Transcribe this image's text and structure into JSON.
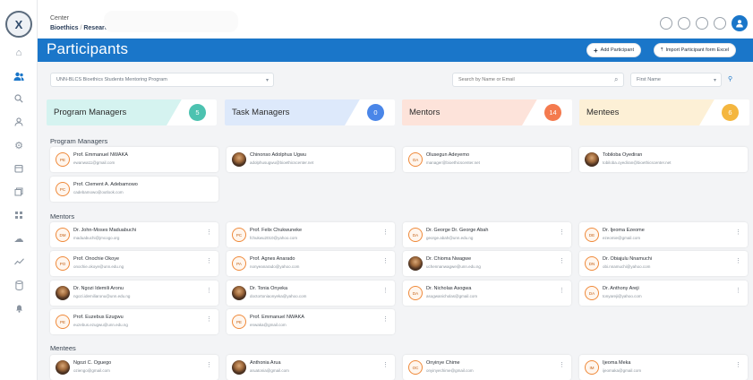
{
  "app": {
    "logo_text": "X",
    "breadcrumb_top": "Center",
    "breadcrumb_parent": "Bioethics",
    "breadcrumb_current": "Research"
  },
  "icons": {
    "sidebar": [
      "home-icon",
      "users-icon",
      "search-icon",
      "user-icon",
      "settings-icon",
      "calendar-icon",
      "gallery-icon",
      "grid-icon",
      "cloud-icon",
      "chart-icon",
      "database-icon",
      "bell-icon"
    ],
    "header": [
      "help-icon",
      "settings-icon",
      "notification-icon",
      "message-icon",
      "user-avatar-icon"
    ]
  },
  "colors": {
    "primary": "#1a76c9",
    "program_managers_bg": "#d5f3f0",
    "program_managers_count": "#4cc2b0",
    "task_managers_bg": "#dde9fb",
    "task_managers_count": "#4a86e8",
    "mentors_bg": "#fde3da",
    "mentors_count": "#f47a4e",
    "mentees_bg": "#fdf0d6",
    "mentees_count": "#f4b63f"
  },
  "header": {
    "title": "Participants",
    "add_button": "Add Participant",
    "import_button": "Import Participant form Excel"
  },
  "filters": {
    "program": "UNN-BLCS Bioethics Students Mentoring Program",
    "search_placeholder": "Search by Name or Email",
    "sort": "First Name"
  },
  "categories": [
    {
      "label": "Program Managers",
      "count": "5"
    },
    {
      "label": "Task Managers",
      "count": "0"
    },
    {
      "label": "Mentors",
      "count": "14"
    },
    {
      "label": "Mentees",
      "count": "6"
    }
  ],
  "sections": {
    "program_managers": "Program Managers",
    "mentors": "Mentors",
    "mentees": "Mentees"
  },
  "program_managers": [
    {
      "initials": "PE",
      "name": "Prof. Emmanuel NWAKA",
      "email": "ewanwa11@gmail.com"
    },
    {
      "initials": "",
      "name": "Chinonso Adolphus Ugwu",
      "email": "adolphusugwu@bioethicscenter.net"
    },
    {
      "initials": "OA",
      "name": "Olusegun Adeyemo",
      "email": "manager@bioethicscenter.net"
    },
    {
      "initials": "",
      "name": "Tobiloba Oyediran",
      "email": "tobiloba.oyediran@bioethicscenter.net"
    },
    {
      "initials": "PC",
      "name": "Prof. Clement A. Adebamowo",
      "email": "cadebamowo@outlook.com"
    }
  ],
  "mentors": [
    {
      "initials": "DM",
      "name": "Dr. John-Moses Maduabuchi",
      "email": "maduabuchi@jmcogo.org"
    },
    {
      "initials": "PC",
      "name": "Prof. Felix Chukwuneke",
      "email": "fchukwu2010@yahoo.com"
    },
    {
      "initials": "DA",
      "name": "Dr. George Dr. George Abah",
      "email": "george.abah@unn.edu.ng"
    },
    {
      "initials": "DE",
      "name": "Dr. Ijeoma Ezeome",
      "email": "ezeomie@gmail.com"
    },
    {
      "initials": "PO",
      "name": "Prof. Onochie Okoye",
      "email": "onochie.okoye@unn.edu.ng"
    },
    {
      "initials": "PA",
      "name": "Prof. Agnes Anarado",
      "email": "nonyeanarado@yahoo.com"
    },
    {
      "initials": "",
      "name": "Dr. Chioma Nwagwe",
      "email": "uchennanwagwe@unn.edu.ng"
    },
    {
      "initials": "DN",
      "name": "Dr. Obiajulu Nnamuchi",
      "email": "obi.nnamuchi@yahoo.com"
    },
    {
      "initials": "",
      "name": "Dr. Ngozi Idemili Aronu",
      "email": "ngozi.idemiliaronu@unn.edu.ng"
    },
    {
      "initials": "",
      "name": "Dr. Tonia Onyeka",
      "email": "doctortoniaonyeka@yahoo.com"
    },
    {
      "initials": "DA",
      "name": "Dr. Nicholas Asogwa",
      "email": "asogwanicholas@gmail.com"
    },
    {
      "initials": "DA",
      "name": "Dr. Anthony Areji",
      "email": "tonyareji@yahoo.com"
    },
    {
      "initials": "PE",
      "name": "Prof. Euzebus Ezugwu",
      "email": "euzebus.ezugwu@unn.edu.ng"
    },
    {
      "initials": "PE",
      "name": "Prof. Emmanuel NWAKA",
      "email": "enwaka@gmail.com"
    }
  ],
  "mentees": [
    {
      "initials": "",
      "name": "Ngozi C. Oguego",
      "email": "oziengo@gmail.com"
    },
    {
      "initials": "",
      "name": "Anthonia Arua",
      "email": "aruatonia@gmail.com"
    },
    {
      "initials": "OC",
      "name": "Onyinye Chime",
      "email": "onyinyechime@gmail.com"
    },
    {
      "initials": "IM",
      "name": "Ijeoma Meka",
      "email": "ijeomaka@gmail.com"
    }
  ]
}
